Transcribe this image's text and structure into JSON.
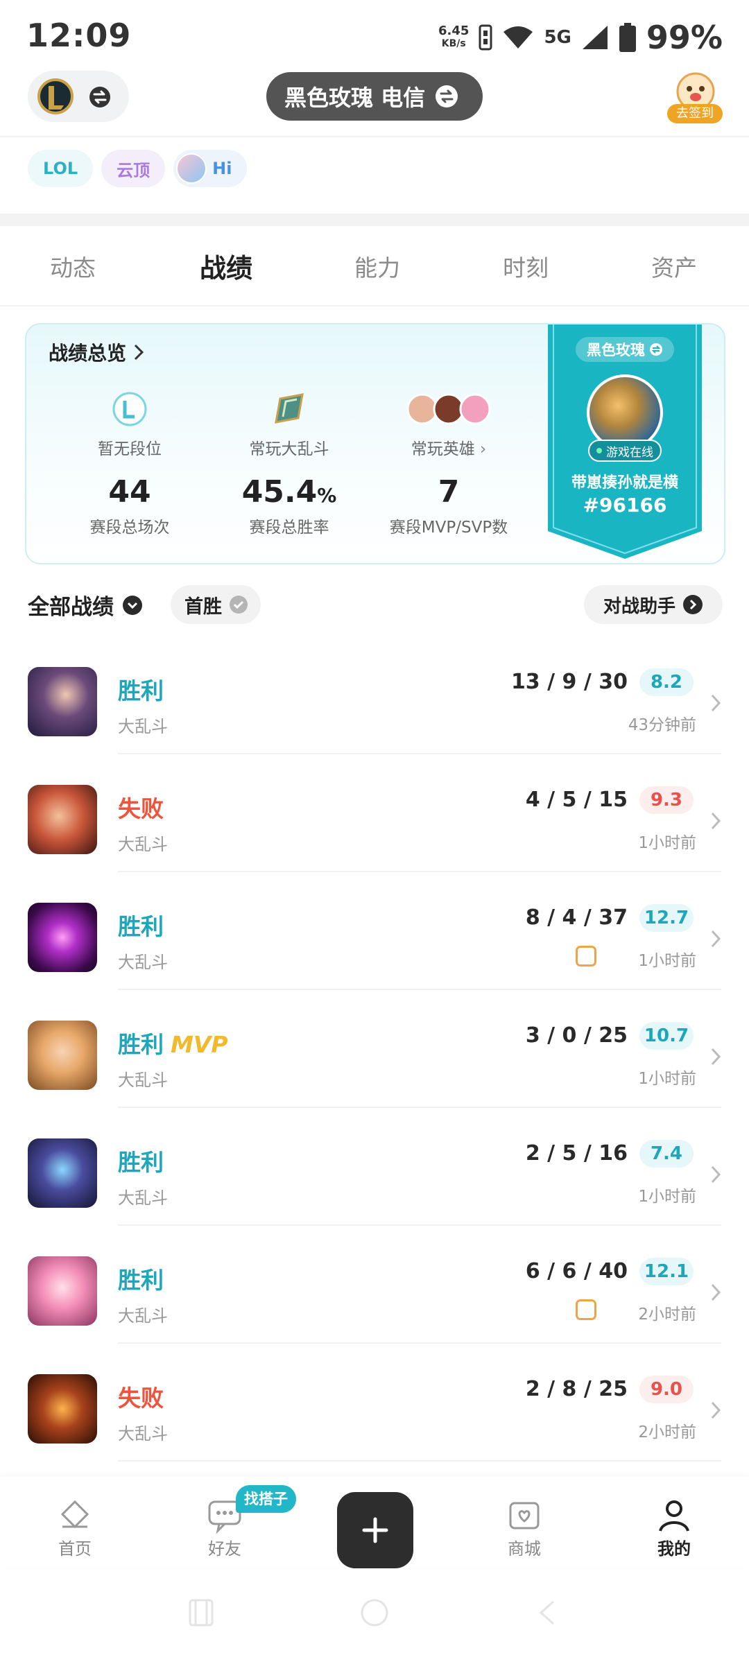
{
  "status_bar": {
    "time": "12:09",
    "speed_value": "6.45",
    "speed_unit": "KB/s",
    "network": "5G",
    "battery": "99%"
  },
  "header": {
    "server": "黑色玫瑰 电信",
    "checkin_label": "去签到"
  },
  "game_tags": [
    {
      "label": "LOL"
    },
    {
      "label": "云顶"
    },
    {
      "label": "Hi"
    }
  ],
  "tabs": [
    {
      "label": "动态",
      "active": false
    },
    {
      "label": "战绩",
      "active": true
    },
    {
      "label": "能力",
      "active": false
    },
    {
      "label": "时刻",
      "active": false
    },
    {
      "label": "资产",
      "active": false
    }
  ],
  "summary": {
    "title": "战绩总览",
    "columns": [
      {
        "label": "暂无段位",
        "value": "44",
        "sub": "赛段总场次"
      },
      {
        "label": "常玩大乱斗",
        "value": "45.4",
        "unit": "%",
        "sub": "赛段总胜率"
      },
      {
        "label": "常玩英雄",
        "value": "7",
        "sub": "赛段MVP/SVP数"
      }
    ],
    "banner": {
      "server": "黑色玫瑰",
      "status": "游戏在线",
      "nickname": "带崽揍孙就是横",
      "tag": "#96166"
    }
  },
  "filters": {
    "all": "全部战绩",
    "first_win": "首胜",
    "assistant": "对战助手"
  },
  "matches": [
    {
      "result": "胜利",
      "outcome": "win",
      "mode": "大乱斗",
      "kda": "13 / 9 / 30",
      "score": "8.2",
      "time": "43分钟前",
      "mvp": "",
      "first": false
    },
    {
      "result": "失败",
      "outcome": "lose",
      "mode": "大乱斗",
      "kda": "4 / 5 / 15",
      "score": "9.3",
      "time": "1小时前",
      "mvp": "",
      "first": false
    },
    {
      "result": "胜利",
      "outcome": "win",
      "mode": "大乱斗",
      "kda": "8 / 4 / 37",
      "score": "12.7",
      "time": "1小时前",
      "mvp": "",
      "first": true
    },
    {
      "result": "胜利",
      "outcome": "win",
      "mode": "大乱斗",
      "kda": "3 / 0 / 25",
      "score": "10.7",
      "time": "1小时前",
      "mvp": "MVP",
      "first": false
    },
    {
      "result": "胜利",
      "outcome": "win",
      "mode": "大乱斗",
      "kda": "2 / 5 / 16",
      "score": "7.4",
      "time": "1小时前",
      "mvp": "",
      "first": false
    },
    {
      "result": "胜利",
      "outcome": "win",
      "mode": "大乱斗",
      "kda": "6 / 6 / 40",
      "score": "12.1",
      "time": "2小时前",
      "mvp": "",
      "first": true
    },
    {
      "result": "失败",
      "outcome": "lose",
      "mode": "大乱斗",
      "kda": "2 / 8 / 25",
      "score": "9.0",
      "time": "2小时前",
      "mvp": "",
      "first": false
    }
  ],
  "bottom_nav": [
    {
      "label": "首页",
      "icon": "home-icon",
      "active": false
    },
    {
      "label": "好友",
      "icon": "chat-icon",
      "active": false,
      "badge": "找搭子"
    },
    {
      "label": "商城",
      "icon": "shop-icon",
      "active": false
    },
    {
      "label": "我的",
      "icon": "profile-icon",
      "active": true
    }
  ],
  "colors": {
    "win": "#1ea7bb",
    "lose": "#f0533c",
    "accent": "#22b7c8",
    "mvp": "#f1b92c"
  }
}
